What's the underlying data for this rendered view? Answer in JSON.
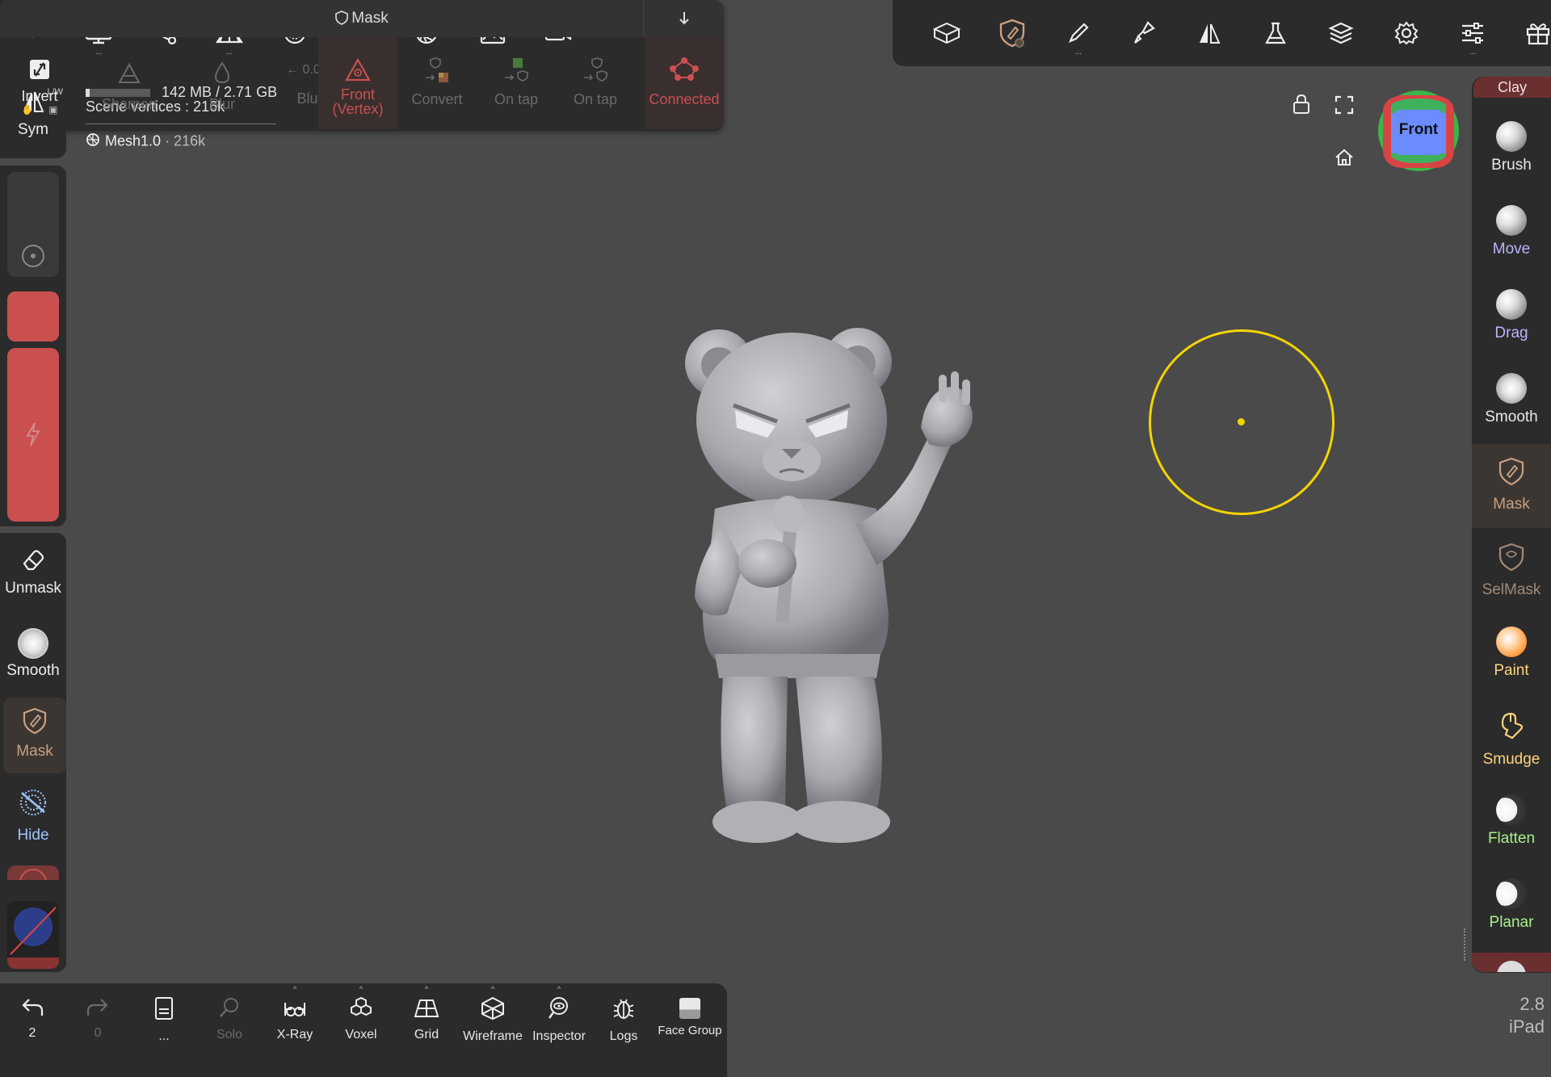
{
  "colors": {
    "background": "#4a4a4a",
    "panel": "#2b2b2b",
    "accent_red": "#c9504f",
    "brush_cursor": "#f3d400",
    "mask_tool": "#c8a182",
    "move_label": "#b9b4ff",
    "paint_label": "#ffd37a",
    "flatten_label": "#a9f08a"
  },
  "top_toolbar_left": [
    {
      "icon": "scene-menu-icon"
    },
    {
      "icon": "display-icon"
    },
    {
      "icon": "scene-graph-icon"
    },
    {
      "icon": "topology-icon"
    },
    {
      "icon": "material-sphere-icon"
    },
    {
      "icon": "light-icon"
    },
    {
      "icon": "aperture-icon"
    },
    {
      "icon": "background-image-icon"
    },
    {
      "icon": "camera-icon"
    }
  ],
  "top_toolbar_right": [
    {
      "icon": "box-tools-icon"
    },
    {
      "icon": "mask-tool-icon"
    },
    {
      "icon": "stroke-icon"
    },
    {
      "icon": "painting-icon"
    },
    {
      "icon": "symmetry-icon"
    },
    {
      "icon": "beaker-icon"
    },
    {
      "icon": "layers-icon"
    },
    {
      "icon": "settings-icon"
    },
    {
      "icon": "sliders-icon"
    },
    {
      "icon": "gift-icon"
    }
  ],
  "info": {
    "memory": "142 MB / 2.71 GB",
    "scene_vertices": "Scene vertices : 216k",
    "mesh_name": "Mesh1.0",
    "mesh_vertices": "· 216k"
  },
  "left_column": {
    "sym_label": "Sym",
    "sym_superscript": "L/W",
    "unmask_label": "Unmask",
    "smooth_label": "Smooth",
    "mask_label": "Mask",
    "hide_label": "Hide"
  },
  "mask_panel": {
    "title": "Mask",
    "tools": [
      {
        "name": "invert",
        "label": "Invert",
        "sub": "",
        "state": "enabled"
      },
      {
        "name": "sharpen",
        "label": "Sharpen",
        "sub": "",
        "state": "disabled"
      },
      {
        "name": "blur",
        "label": "Blur",
        "sub": "",
        "state": "disabled"
      },
      {
        "name": "blur-percent",
        "label": "Blur →",
        "value": "← 0.0 % →",
        "state": "disabled"
      },
      {
        "name": "front",
        "label": "Front",
        "sub": "(Vertex)",
        "state": "active"
      },
      {
        "name": "convert",
        "label": "Convert",
        "sub": "",
        "state": "disabled"
      },
      {
        "name": "on-tap-1",
        "label": "On tap",
        "sub": "",
        "state": "disabled"
      },
      {
        "name": "on-tap-2",
        "label": "On tap",
        "sub": "",
        "state": "disabled"
      },
      {
        "name": "connected",
        "label": "Connected",
        "sub": "",
        "state": "active"
      }
    ]
  },
  "view": {
    "gizmo_label": "Front"
  },
  "right_column": {
    "header": "Clay",
    "tools": [
      {
        "label": "Brush",
        "color": "#e8e8e8"
      },
      {
        "label": "Move",
        "color": "#b9b4ff"
      },
      {
        "label": "Drag",
        "color": "#b9b4ff"
      },
      {
        "label": "Smooth",
        "color": "#e8e8e8"
      },
      {
        "label": "Mask",
        "color": "#c8a182"
      },
      {
        "label": "SelMask",
        "color": "#a08a78"
      },
      {
        "label": "Paint",
        "color": "#ffd37a"
      },
      {
        "label": "Smudge",
        "color": "#ffd37a"
      },
      {
        "label": "Flatten",
        "color": "#a9f08a"
      },
      {
        "label": "Planar",
        "color": "#a9f08a"
      }
    ]
  },
  "bottom_bar": [
    {
      "label": "2",
      "icon": "undo-icon",
      "state": "enabled"
    },
    {
      "label": "0",
      "icon": "redo-icon",
      "state": "disabled"
    },
    {
      "label": "...",
      "icon": "files-icon",
      "state": "enabled"
    },
    {
      "label": "Solo",
      "icon": "solo-icon",
      "state": "disabled"
    },
    {
      "label": "X-Ray",
      "icon": "xray-icon",
      "state": "enabled"
    },
    {
      "label": "Voxel",
      "icon": "voxel-icon",
      "state": "enabled"
    },
    {
      "label": "Grid",
      "icon": "grid-icon",
      "state": "enabled"
    },
    {
      "label": "Wireframe",
      "icon": "wireframe-icon",
      "state": "enabled"
    },
    {
      "label": "Inspector",
      "icon": "inspector-icon",
      "state": "enabled"
    },
    {
      "label": "Logs",
      "icon": "logs-icon",
      "state": "enabled"
    },
    {
      "label": "Face Group",
      "icon": "face-group-icon",
      "state": "enabled"
    }
  ],
  "version": {
    "number": "2.8",
    "device": "iPad"
  }
}
